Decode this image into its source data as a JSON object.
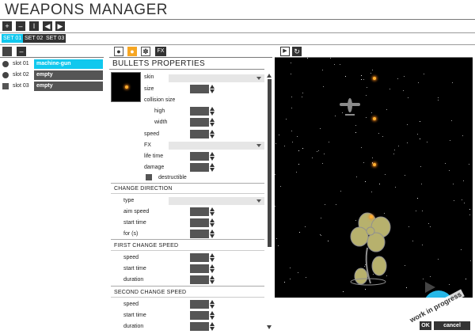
{
  "app": {
    "title": "WEAPONS MANAGER"
  },
  "toolbar": {
    "icons": [
      "add-icon",
      "trash-icon",
      "text-cursor-icon",
      "arrow-left-icon",
      "arrow-right-icon"
    ]
  },
  "sets": [
    {
      "label": "SET 01",
      "active": true
    },
    {
      "label": "SET 02",
      "active": false
    },
    {
      "label": "SET 03",
      "active": false
    }
  ],
  "slots": [
    {
      "label": "slot 01",
      "value": "machine-gun",
      "selected": true
    },
    {
      "label": "slot 02",
      "value": "empty",
      "selected": false
    },
    {
      "label": "slot 03",
      "value": "empty",
      "selected": false
    }
  ],
  "props_tabs": {
    "icons": [
      "bulb-icon",
      "bullet-icon",
      "explosion-icon"
    ],
    "fx_label": "FX"
  },
  "properties": {
    "header": "BULLETS PROPERTIES",
    "skin": "skin",
    "size": "size",
    "collision_size": "collision size",
    "high": "high",
    "width": "width",
    "speed": "speed",
    "fx": "FX",
    "life_time": "life time",
    "damage": "damage",
    "destructible": "destructible"
  },
  "change_direction": {
    "header": "CHANGE DIRECTION",
    "type": "type",
    "aim_speed": "aim speed",
    "start_time": "start time",
    "for_s": "for (s)"
  },
  "first_change_speed": {
    "header": "FIRST CHANGE SPEED",
    "speed": "speed",
    "start_time": "start time",
    "duration": "duration"
  },
  "second_change_speed": {
    "header": "SECOND CHANGE SPEED",
    "speed": "speed",
    "start_time": "start time",
    "duration": "duration"
  },
  "preview_controls": {
    "icons": [
      "play-icon",
      "reload-icon"
    ]
  },
  "badge": {
    "text": "work in progress"
  },
  "actions": {
    "ok": "OK",
    "cancel": "cancel"
  },
  "colors": {
    "accent": "#11c8ee",
    "dark": "#333333",
    "field": "#555555",
    "preview_bg": "#000000",
    "bullet": "#ffb030"
  }
}
